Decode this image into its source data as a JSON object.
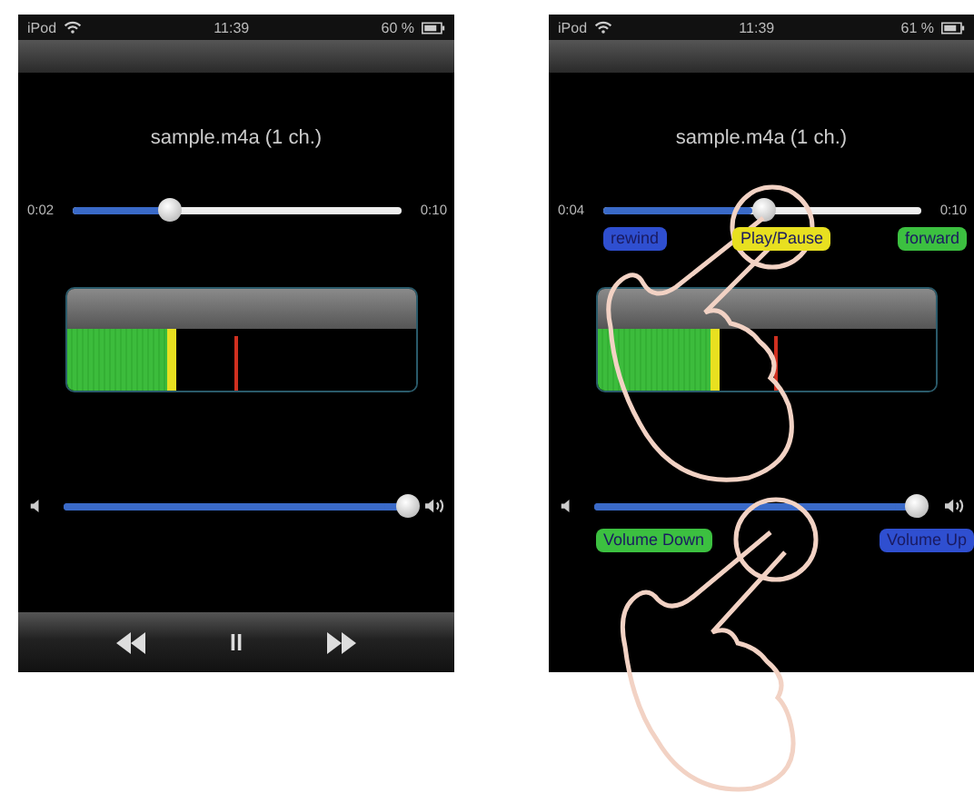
{
  "screens": [
    {
      "status": {
        "carrier": "iPod",
        "time": "11:39",
        "battery": "60 %"
      },
      "title": "sample.m4a (1 ch.)",
      "seek": {
        "elapsed": "0:02",
        "total": "0:10",
        "level": 0.28
      },
      "meter": {
        "level": 0.31,
        "peak": {
          "level": 0.48
        }
      },
      "volume": {
        "level": 0.95
      },
      "toolbar": [
        {
          "kind": "rewind"
        },
        {
          "kind": "pause"
        },
        {
          "kind": "forward"
        }
      ],
      "gesture_overlay": false
    },
    {
      "status": {
        "carrier": "iPod",
        "time": "11:39",
        "battery": "61 %"
      },
      "title": "sample.m4a (1 ch.)",
      "seek": {
        "elapsed": "0:04",
        "total": "0:10",
        "level": 0.47,
        "labels": [
          {
            "text": "rewind",
            "color": "#2f4fd0"
          },
          {
            "text": "Play/Pause",
            "color": "#e8e020"
          },
          {
            "text": "forward",
            "color": "#3cc040"
          }
        ]
      },
      "meter": {
        "level": 0.36,
        "peak": {
          "level": 0.52
        }
      },
      "volume": {
        "level": 0.92,
        "labels": [
          {
            "text": "Volume Down",
            "color": "#3cc040"
          },
          {
            "text": "Volume Up",
            "color": "#2f4fd0"
          }
        ]
      },
      "gesture_overlay": true
    }
  ]
}
